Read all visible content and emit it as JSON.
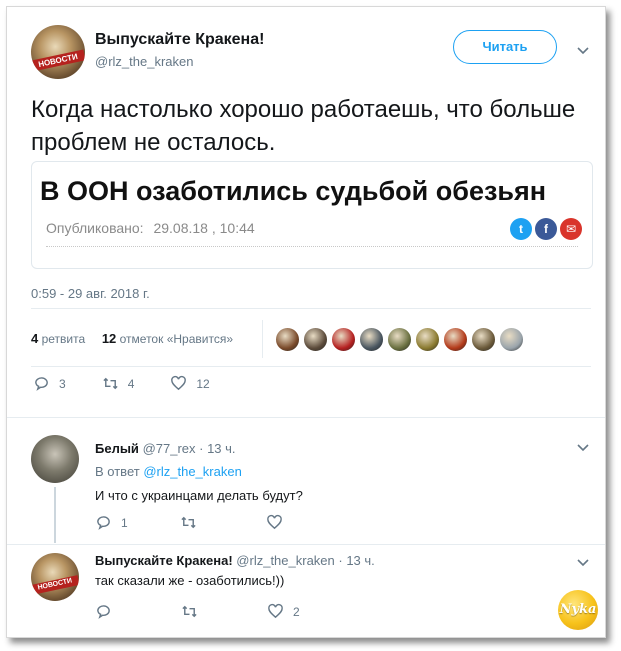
{
  "tweet": {
    "author_name": "Выпускайте Кракена!",
    "author_handle": "@rlz_the_kraken",
    "avatar_label": "НОВОСТИ",
    "follow_label": "Читать",
    "text": "Когда настолько хорошо работаешь, что больше проблем не осталось.",
    "timestamp": "0:59 - 29 авг. 2018 г.",
    "retweet_count": "4",
    "retweet_label": "ретвита",
    "like_count": "12",
    "like_label": "отметок «Нравится»",
    "actions": {
      "reply_count": "3",
      "retweet_count": "4",
      "like_count": "12"
    },
    "liker_avatar_colors": [
      "#7a4a2a",
      "#5b4a3a",
      "#b52020",
      "#4a5660",
      "#6a7040",
      "#8a7a30",
      "#b33a1a",
      "#6b5a3a",
      "#9aa4ab"
    ]
  },
  "link_card": {
    "headline": "В ООН озаботились судьбой обезьян",
    "published_label": "Опубликовано:",
    "published_date": "29.08.18 , 10:44",
    "share_icons": [
      {
        "name": "twitter-icon",
        "glyph": "t",
        "color": "#1da1f2"
      },
      {
        "name": "facebook-icon",
        "glyph": "f",
        "color": "#3b5998"
      },
      {
        "name": "mail-icon",
        "glyph": "✉",
        "color": "#d9342b"
      }
    ]
  },
  "replies": [
    {
      "name": "Белый",
      "handle": "@77_rex",
      "time": "· 13 ч.",
      "reply_to_prefix": "В ответ",
      "reply_to_handle": "@rlz_the_kraken",
      "text": "И что с украинцами делать будут?",
      "reply_count": "1",
      "retweet_count": "",
      "like_count": ""
    },
    {
      "name": "Выпускайте Кракена!",
      "handle": "@rlz_the_kraken",
      "time": "· 13 ч.",
      "text": "так сказали же - озаботились!))",
      "reply_count": "",
      "retweet_count": "",
      "like_count": "2"
    }
  ],
  "watermark": "Nyka",
  "colors": {
    "accent": "#1da1f2",
    "muted": "#657786",
    "text": "#14171a"
  }
}
